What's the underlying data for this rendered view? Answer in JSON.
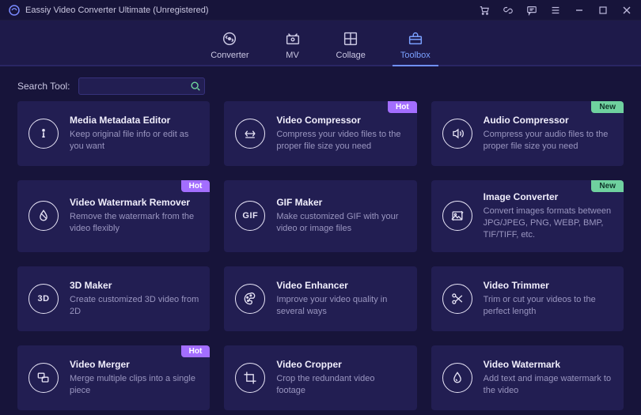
{
  "app": {
    "title": "Eassiy Video Converter Ultimate (Unregistered)"
  },
  "tabs": {
    "converter": "Converter",
    "mv": "MV",
    "collage": "Collage",
    "toolbox": "Toolbox",
    "active": "toolbox"
  },
  "search": {
    "label": "Search Tool:",
    "value": ""
  },
  "badges": {
    "hot": "Hot",
    "new": "New"
  },
  "tools": [
    {
      "id": "media-metadata-editor",
      "title": "Media Metadata Editor",
      "desc": "Keep original file info or edit as you want",
      "icon": "info",
      "badge": null
    },
    {
      "id": "video-compressor",
      "title": "Video Compressor",
      "desc": "Compress your video files to the proper file size you need",
      "icon": "compress",
      "badge": "hot"
    },
    {
      "id": "audio-compressor",
      "title": "Audio Compressor",
      "desc": "Compress your audio files to the proper file size you need",
      "icon": "audio",
      "badge": "new"
    },
    {
      "id": "video-watermark-remover",
      "title": "Video Watermark Remover",
      "desc": "Remove the watermark from the video flexibly",
      "icon": "drop",
      "badge": "hot"
    },
    {
      "id": "gif-maker",
      "title": "GIF Maker",
      "desc": "Make customized GIF with your video or image files",
      "icon": "gif",
      "badge": null
    },
    {
      "id": "image-converter",
      "title": "Image Converter",
      "desc": "Convert images formats between JPG/JPEG, PNG, WEBP, BMP, TIF/TIFF, etc.",
      "icon": "imageconv",
      "badge": "new"
    },
    {
      "id": "3d-maker",
      "title": "3D Maker",
      "desc": "Create customized 3D video from 2D",
      "icon": "3d",
      "badge": null
    },
    {
      "id": "video-enhancer",
      "title": "Video Enhancer",
      "desc": "Improve your video quality in several ways",
      "icon": "palette",
      "badge": null
    },
    {
      "id": "video-trimmer",
      "title": "Video Trimmer",
      "desc": "Trim or cut your videos to the perfect length",
      "icon": "scissors",
      "badge": null
    },
    {
      "id": "video-merger",
      "title": "Video Merger",
      "desc": "Merge multiple clips into a single piece",
      "icon": "merge",
      "badge": "hot"
    },
    {
      "id": "video-cropper",
      "title": "Video Cropper",
      "desc": "Crop the redundant video footage",
      "icon": "crop",
      "badge": null
    },
    {
      "id": "video-watermark",
      "title": "Video Watermark",
      "desc": "Add text and image watermark to the video",
      "icon": "drop2",
      "badge": null
    }
  ]
}
